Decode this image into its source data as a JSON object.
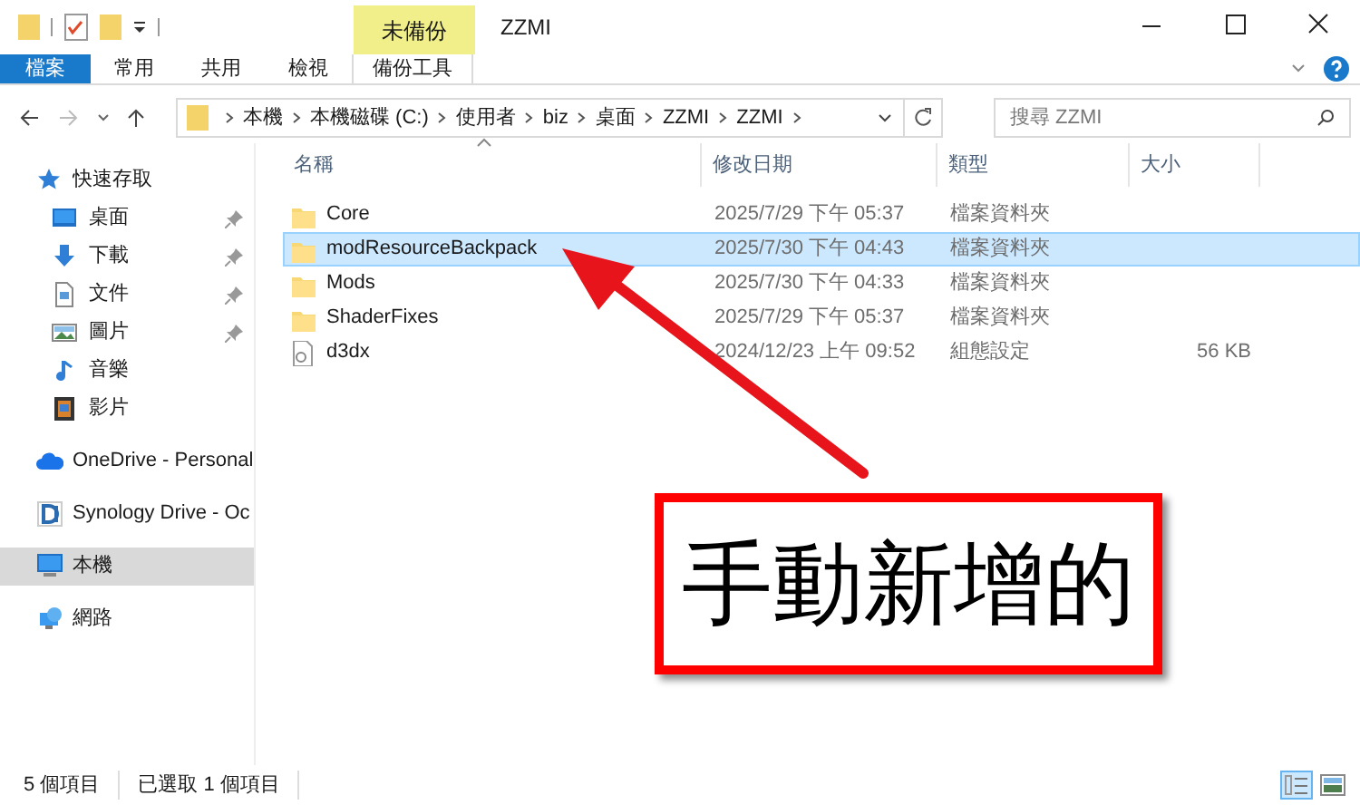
{
  "title_bar": {
    "context_group": "未備份",
    "title": "ZZMI"
  },
  "ribbon_tabs": [
    {
      "label": "檔案",
      "kind": "file",
      "selected": false
    },
    {
      "label": "常用",
      "kind": "tab",
      "selected": false
    },
    {
      "label": "共用",
      "kind": "tab",
      "selected": false
    },
    {
      "label": "檢視",
      "kind": "tab",
      "selected": false
    },
    {
      "label": "備份工具",
      "kind": "context",
      "selected": false
    }
  ],
  "address_bar": {
    "crumbs": [
      "本機",
      "本機磁碟 (C:)",
      "使用者",
      "biz",
      "桌面",
      "ZZMI",
      "ZZMI"
    ]
  },
  "search": {
    "placeholder": "搜尋 ZZMI"
  },
  "sidebar": {
    "items": [
      {
        "label": "快速存取",
        "kind": "star",
        "selected": false,
        "children": [
          {
            "label": "桌面",
            "kind": "desktop",
            "pinned": true,
            "selected": false
          },
          {
            "label": "下載",
            "kind": "download",
            "pinned": true,
            "selected": false
          },
          {
            "label": "文件",
            "kind": "document",
            "pinned": true,
            "selected": false
          },
          {
            "label": "圖片",
            "kind": "pictures",
            "pinned": true,
            "selected": false
          },
          {
            "label": "音樂",
            "kind": "music",
            "pinned": false,
            "selected": false
          },
          {
            "label": "影片",
            "kind": "video",
            "pinned": false,
            "selected": false
          }
        ]
      },
      {
        "label": "OneDrive - Personal",
        "kind": "cloud",
        "selected": false
      },
      {
        "label": "Synology Drive - Oc",
        "kind": "synology",
        "selected": false
      },
      {
        "label": "本機",
        "kind": "computer",
        "selected": true
      },
      {
        "label": "網路",
        "kind": "network",
        "selected": false
      }
    ]
  },
  "file_list": {
    "columns": [
      "名稱",
      "修改日期",
      "類型",
      "大小"
    ],
    "rows": [
      {
        "name": "Core",
        "modified": "2025/7/29 下午 05:37",
        "type": "檔案資料夾",
        "kind": "folder",
        "selected": false
      },
      {
        "name": "modResourceBackpack",
        "modified": "2025/7/30 下午 04:43",
        "type": "檔案資料夾",
        "kind": "folder",
        "selected": true
      },
      {
        "name": "Mods",
        "modified": "2025/7/30 下午 04:33",
        "type": "檔案資料夾",
        "kind": "folder",
        "selected": false
      },
      {
        "name": "ShaderFixes",
        "modified": "2025/7/29 下午 05:37",
        "type": "檔案資料夾",
        "kind": "folder",
        "selected": false
      },
      {
        "name": "d3dx",
        "modified": "2024/12/23 上午 09:52",
        "type": "組態設定",
        "size": "56 KB",
        "kind": "config",
        "selected": false
      }
    ]
  },
  "status_bar": {
    "item_count": "5 個項目",
    "selection": "已選取 1 個項目"
  },
  "annotation": {
    "label": "手動新增的"
  }
}
